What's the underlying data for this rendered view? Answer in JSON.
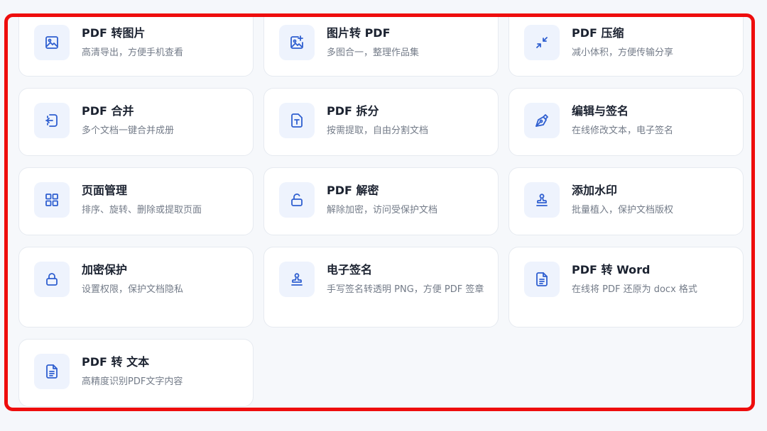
{
  "tools": [
    {
      "title": "PDF 转图片",
      "desc": "高清导出，方便手机查看",
      "icon": "image-icon"
    },
    {
      "title": "图片转 PDF",
      "desc": "多图合一，整理作品集",
      "icon": "image-plus-icon"
    },
    {
      "title": "PDF 压缩",
      "desc": "减小体积，方便传输分享",
      "icon": "compress-icon"
    },
    {
      "title": "PDF 合并",
      "desc": "多个文档一键合并成册",
      "icon": "merge-icon"
    },
    {
      "title": "PDF 拆分",
      "desc": "按需提取，自由分割文档",
      "icon": "split-icon"
    },
    {
      "title": "编辑与签名",
      "desc": "在线修改文本，电子签名",
      "icon": "pen-icon"
    },
    {
      "title": "页面管理",
      "desc": "排序、旋转、删除或提取页面",
      "icon": "grid-icon"
    },
    {
      "title": "PDF 解密",
      "desc": "解除加密，访问受保护文档",
      "icon": "unlock-icon"
    },
    {
      "title": "添加水印",
      "desc": "批量植入，保护文档版权",
      "icon": "stamp-icon"
    },
    {
      "title": "加密保护",
      "desc": "设置权限，保护文档隐私",
      "icon": "lock-icon"
    },
    {
      "title": "电子签名",
      "desc": "手写签名转透明 PNG，方便 PDF 签章",
      "icon": "stamp-icon"
    },
    {
      "title": "PDF 转 Word",
      "desc": "在线将 PDF 还原为 docx 格式",
      "icon": "document-icon"
    },
    {
      "title": "PDF 转 文本",
      "desc": "高精度识别PDF文字内容",
      "icon": "document-text-icon"
    }
  ],
  "colors": {
    "accent": "#2f5fd0",
    "highlight_border": "#ee0d0d",
    "icon_bg": "#eef3fd"
  }
}
